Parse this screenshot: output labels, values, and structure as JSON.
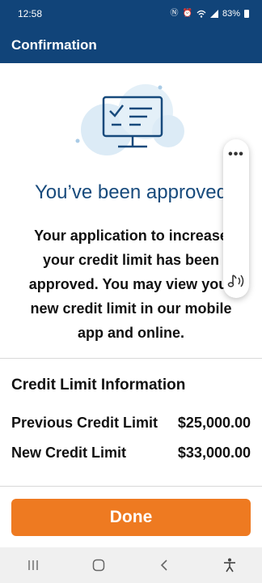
{
  "status": {
    "time": "12:58",
    "battery": "83%"
  },
  "appbar": {
    "title": "Confirmation"
  },
  "main": {
    "heading": "You’ve been approved",
    "message": "Your application to increase your credit limit has been approved. You may view your new credit limit in our mobile app and online."
  },
  "credit": {
    "title": "Credit Limit Information",
    "rows": [
      {
        "label": "Previous Credit Limit",
        "value": "$25,000.00"
      },
      {
        "label": "New Credit Limit",
        "value": "$33,000.00"
      }
    ]
  },
  "actions": {
    "done_label": "Done"
  },
  "floating_panel": {
    "menu_icon": "more-horizontal-icon",
    "sound_icon": "read-aloud-icon"
  },
  "colors": {
    "header": "#114479",
    "heading_text": "#174a7c",
    "primary_button": "#ee7a21"
  }
}
